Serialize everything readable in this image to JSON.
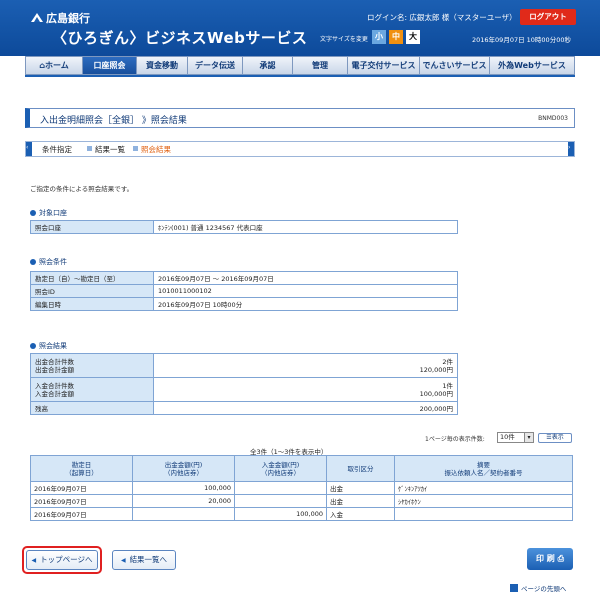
{
  "header": {
    "bank_name": "広島銀行",
    "service_name": "〈ひろぎん〉ビジネスWebサービス",
    "login_info": "ログイン名: 広銀太郎 様（マスターユーザ）",
    "logout_label": "ログアウト",
    "font_size_label": "文字サイズを変更",
    "font_size_options": [
      "小",
      "中",
      "大"
    ],
    "datetime": "2016年09月07日 10時00分00秒"
  },
  "nav": {
    "items": [
      {
        "label": "ホーム",
        "active": false
      },
      {
        "label": "口座照会",
        "active": true
      },
      {
        "label": "資金移動",
        "active": false
      },
      {
        "label": "データ伝送",
        "active": false
      },
      {
        "label": "承認",
        "active": false
      },
      {
        "label": "管理",
        "active": false
      },
      {
        "label": "電子交付サービス",
        "active": false
      },
      {
        "label": "でんさいサービス",
        "active": false
      },
      {
        "label": "外為Webサービス",
        "active": false
      }
    ]
  },
  "page": {
    "title": "入出金明細照会［全銀］ 》照会結果",
    "screen_code": "BNMD003",
    "steps": [
      "条件指定",
      "結果一覧",
      "照会結果"
    ],
    "intro": "ご指定の条件による照会結果です。"
  },
  "target_account": {
    "heading": "対象口座",
    "label": "照会口座",
    "value": "ﾎﾝﾃﾝ(001) 普通 1234567 代表口座"
  },
  "conditions": {
    "heading": "照会条件",
    "rows": [
      {
        "label": "勘定日（自）～勘定日（至）",
        "value": "2016年09月07日 ～ 2016年09月07日"
      },
      {
        "label": "照会ID",
        "value": "1010011000102"
      },
      {
        "label": "編集日時",
        "value": "2016年09月07日 10時00分"
      }
    ]
  },
  "results": {
    "heading": "照会結果",
    "withdraw_label_1": "出金合計件数",
    "withdraw_label_2": "出金合計金額",
    "withdraw_count": "2件",
    "withdraw_amount": "120,000円",
    "deposit_label_1": "入金合計件数",
    "deposit_label_2": "入金合計金額",
    "deposit_count": "1件",
    "deposit_amount": "100,000円",
    "balance_label": "残高",
    "balance_value": "200,000円"
  },
  "list": {
    "per_page_label": "1ページ毎の表示件数:",
    "per_page_value": "10件",
    "show_button": "表示",
    "count_caption": "全3件（1～3件を表示中）",
    "headers": [
      [
        "勘定日",
        "（起算日）"
      ],
      [
        "出金金額(円)",
        "（内他店券）"
      ],
      [
        "入金金額(円)",
        "（内他店券）"
      ],
      [
        "取引区分",
        ""
      ],
      [
        "摘要",
        "振込依頼人名／契約者番号"
      ]
    ],
    "rows": [
      {
        "date": "2016年09月07日",
        "withdraw": "100,000",
        "deposit": "",
        "type": "出金",
        "memo": "ｹﾞﾝｷﾝｱﾂｶｲ"
      },
      {
        "date": "2016年09月07日",
        "withdraw": "20,000",
        "deposit": "",
        "type": "出金",
        "memo": "ｼﾔｶｲﾎｹﾝ"
      },
      {
        "date": "2016年09月07日",
        "withdraw": "",
        "deposit": "100,000",
        "type": "入金",
        "memo": ""
      }
    ]
  },
  "buttons": {
    "top_page": "トップページへ",
    "result_list": "結果一覧へ",
    "print": "印 刷",
    "page_top": "ページの先頭へ"
  }
}
